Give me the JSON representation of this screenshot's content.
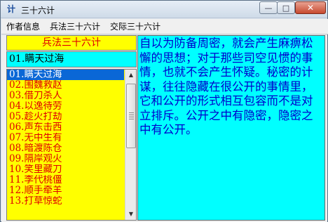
{
  "window": {
    "icon_glyph": "计",
    "title": "三十六计"
  },
  "titlebar_buttons": {
    "minimize": "—",
    "maximize": "□",
    "close": "✕"
  },
  "menu": [
    "作者信息",
    "兵法三十六计",
    "交际三十六计"
  ],
  "panel_header": "兵法三十六计",
  "selected_entry": "01.瞒天过海",
  "list_items": [
    "01.瞒天过海",
    "02.围魏救赵",
    "03.借刀杀人",
    "04.以逸待劳",
    "05.趁火打劫",
    "06.声东击西",
    "07.无中生有",
    "08.暗渡陈仓",
    "09.隔岸观火",
    "10.笑里藏刀",
    "11.李代桃僵",
    "12.顺手牵羊",
    "13.打草惊蛇"
  ],
  "selected_index": 0,
  "scrollbar": {
    "up": "▲",
    "down": "▼"
  },
  "description": "自以为防备周密，就会产生麻痹松懈的思想；对于那些司空见惯的事情，也就不会产生怀疑。秘密的计谋，往往隐藏在很公开的事情里，它和公开的形式相互包容而不是对立排斥。公开之中有隐密，隐密之中有公开。",
  "colors": {
    "header_bg": "#ffff00",
    "header_text": "#e00000",
    "list_bg": "#ffff00",
    "list_text": "#e00000",
    "selection_bg": "#0a67d6",
    "panel_bg": "#00ffff",
    "panel_text": "#0000cc"
  }
}
